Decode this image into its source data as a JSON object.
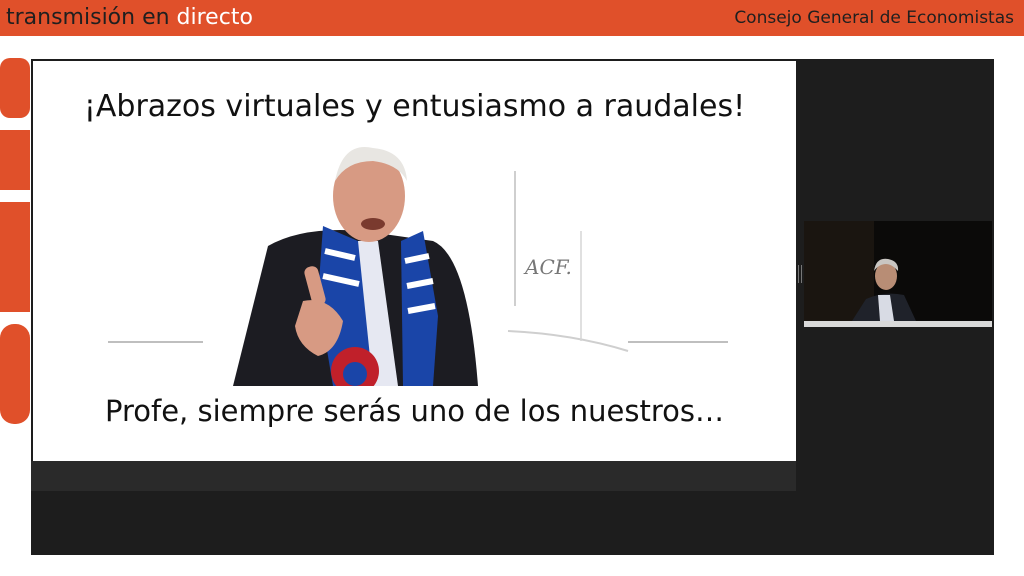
{
  "header": {
    "title_prefix": "transmisión en ",
    "title_accent": "directo",
    "organization": "Consejo General de Economistas"
  },
  "slide": {
    "title": "¡Abrazos virtuales y entusiasmo a raudales!",
    "caption": "Profe, siempre serás uno de los nuestros…",
    "whiteboard_text": "ACF."
  },
  "colors": {
    "brand": "#e0502a",
    "player_bg": "#1d1d1d"
  },
  "icons": {
    "camera_handle": "drag-handle-icon"
  }
}
